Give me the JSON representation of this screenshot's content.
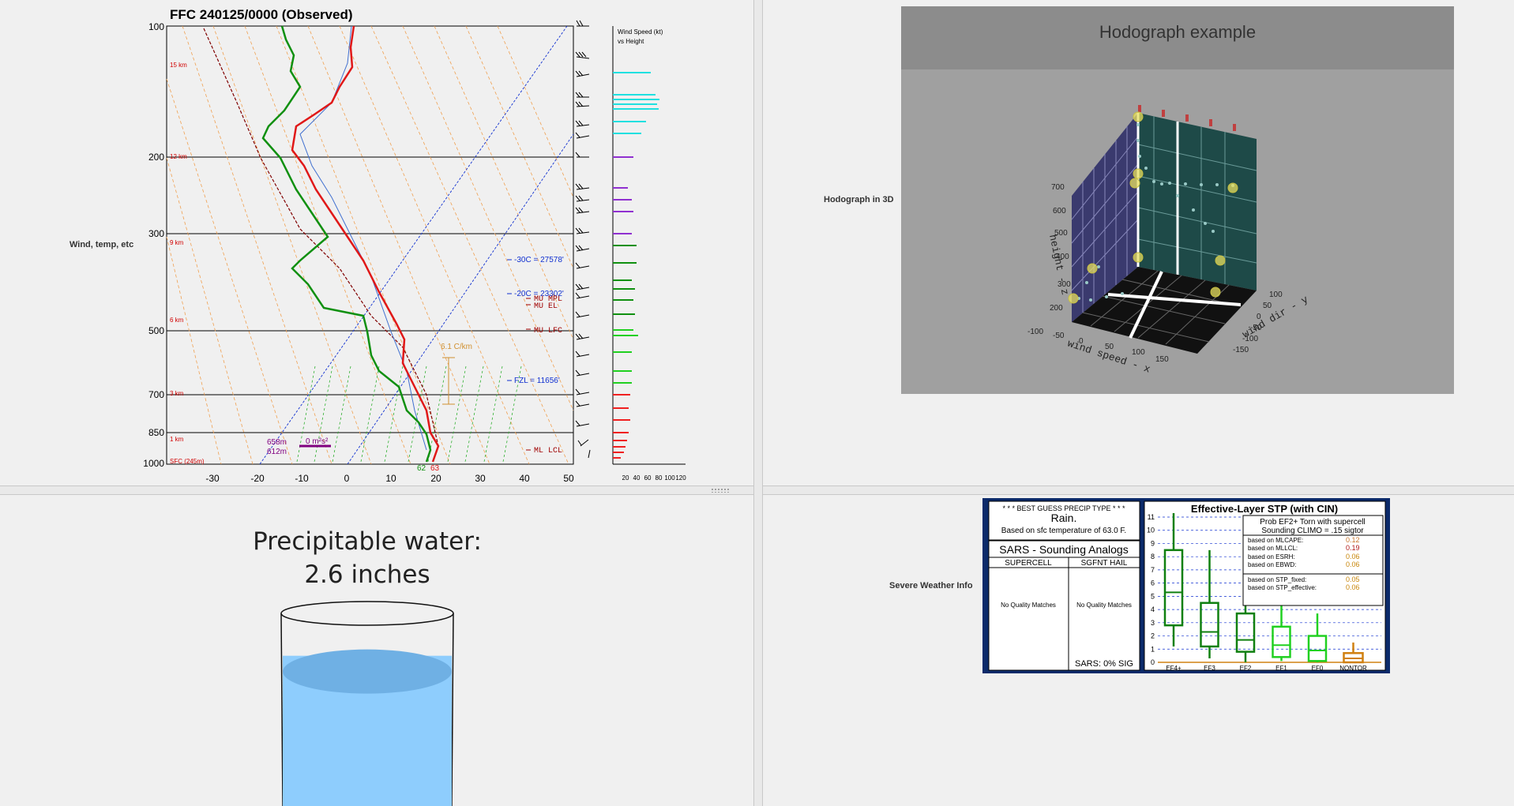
{
  "skewt": {
    "label": "Wind, temp, etc",
    "title": "FFC   240125/0000  (Observed)",
    "pressure_ticks": [
      "100",
      "200",
      "300",
      "500",
      "700",
      "850",
      "1000"
    ],
    "temp_ticks": [
      "-30",
      "-20",
      "-10",
      "0",
      "10",
      "20",
      "30",
      "40",
      "50"
    ],
    "height_ticks": [
      "15 km",
      "12 km",
      "9 km",
      "6 km",
      "3 km",
      "1 km",
      "SFC (245m)"
    ],
    "annotations": {
      "m30c": "-30C = 27578'",
      "m20c": "-20C = 23302'",
      "fzl": "FZL = 11656'",
      "mu_mpl": "MU MPL",
      "mu_el": "MU EL",
      "mu_lfc": "MU LFC",
      "ml_lcl": "ML LCL",
      "lapse": "6.1 C/km",
      "h658": "658m",
      "h612": "612m",
      "srh": "0 m²s²",
      "sfc_t": "62",
      "sfc_td": "63"
    },
    "wind_panel": {
      "title1": "Wind Speed (kt)",
      "title2": "vs Height",
      "ticks": [
        "20",
        "40",
        "60",
        "80",
        "100",
        "120"
      ]
    }
  },
  "hodograph": {
    "label": "Hodograph in 3D",
    "title": "Hodograph example",
    "z_label": "height - z",
    "x_label": "wind speed - x",
    "y_label": "wind dir - y",
    "z_ticks": [
      "700",
      "600",
      "500",
      "400",
      "300",
      "200"
    ],
    "x_ticks": [
      "-100",
      "-50",
      "0",
      "50",
      "100",
      "150"
    ],
    "y_ticks": [
      "100",
      "50",
      "0",
      "-50",
      "-100",
      "-150"
    ]
  },
  "precip": {
    "line1": "Precipitable water:",
    "line2": "2.6 inches",
    "fill_fraction": 0.78
  },
  "severe": {
    "label": "Severe Weather Info",
    "precip_type": {
      "header": "* * * BEST GUESS PRECIP TYPE * * *",
      "value": "Rain.",
      "note": "Based on sfc temperature of 63.0 F."
    },
    "sars": {
      "title": "SARS - Sounding Analogs",
      "col1": "SUPERCELL",
      "col2": "SGFNT HAIL",
      "col1_result": "No Quality Matches",
      "col2_result": "No Quality Matches",
      "footer": "SARS:  0% SIG"
    },
    "stp": {
      "title": "Effective-Layer STP (with CIN)",
      "prob_line1": "Prob EF2+ Torn with supercell",
      "prob_line2": "Sounding CLIMO = .15 sigtor",
      "rows": [
        {
          "label": "based on MLCAPE:",
          "value": "0.12",
          "color": "#c8742a"
        },
        {
          "label": "based on MLLCL:",
          "value": "0.19",
          "color": "#b01818"
        },
        {
          "label": "based on ESRH:",
          "value": "0.06",
          "color": "#c8860a"
        },
        {
          "label": "based on EBWD:",
          "value": "0.06",
          "color": "#c8860a"
        },
        {
          "label": "based on STP_fixed:",
          "value": "0.05",
          "color": "#c8860a"
        },
        {
          "label": "based on STP_effective:",
          "value": "0.06",
          "color": "#c8860a"
        }
      ],
      "y_ticks": [
        "0",
        "1",
        "2",
        "3",
        "4",
        "5",
        "6",
        "7",
        "8",
        "9",
        "10",
        "11"
      ],
      "categories": [
        "EF4+",
        "EF3",
        "EF2",
        "EF1",
        "EF0",
        "NONTOR"
      ]
    }
  },
  "chart_data": [
    {
      "type": "box",
      "title": "Effective-Layer STP (with CIN)",
      "categories": [
        "EF4+",
        "EF3",
        "EF2",
        "EF1",
        "EF0",
        "NONTOR"
      ],
      "boxes": [
        {
          "min": 1.2,
          "q1": 2.8,
          "median": 5.3,
          "q3": 8.5,
          "max": 11.3
        },
        {
          "min": 0.3,
          "q1": 1.2,
          "median": 2.3,
          "q3": 4.5,
          "max": 8.5
        },
        {
          "min": 0.0,
          "q1": 0.8,
          "median": 1.7,
          "q3": 3.7,
          "max": 5.6
        },
        {
          "min": 0.1,
          "q1": 0.4,
          "median": 1.3,
          "q3": 2.7,
          "max": 4.5
        },
        {
          "min": 0.0,
          "q1": 0.1,
          "median": 0.9,
          "q3": 2.0,
          "max": 3.7
        },
        {
          "min": 0.0,
          "q1": 0.0,
          "median": 0.3,
          "q3": 0.7,
          "max": 1.5
        }
      ],
      "ylim": [
        0,
        11
      ]
    }
  ]
}
